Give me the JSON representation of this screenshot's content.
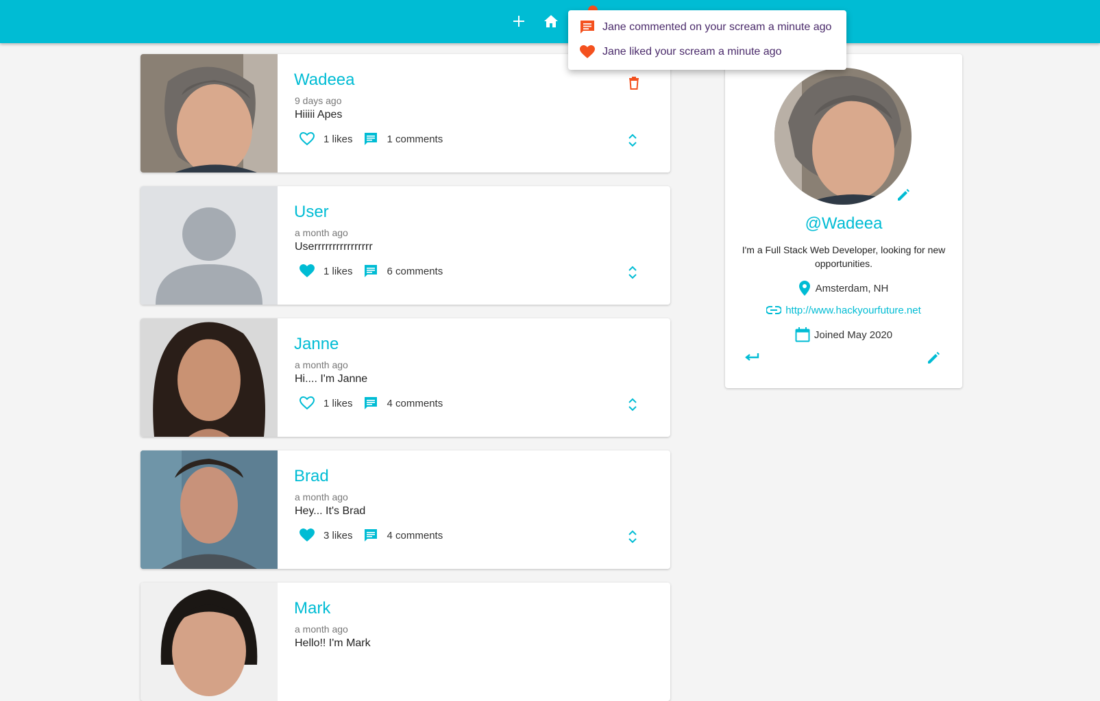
{
  "colors": {
    "primary": "#00bcd4",
    "secondary": "#f4511e",
    "background": "#f4f4f4"
  },
  "navbar": {
    "icons": [
      "add-icon",
      "home-icon",
      "notifications-icon"
    ]
  },
  "notifications": [
    {
      "icon": "comment-icon",
      "text": "Jane commented on your scream a minute ago"
    },
    {
      "icon": "heart-icon",
      "text": "Jane liked your scream a minute ago"
    }
  ],
  "screams": [
    {
      "handle": "Wadeea",
      "time": "9 days ago",
      "body": "Hiiiii Apes",
      "likes": "1 likes",
      "comments": "1 comments",
      "liked": false,
      "deletable": true
    },
    {
      "handle": "User",
      "time": "a month ago",
      "body": "Userrrrrrrrrrrrrrrr",
      "likes": "1 likes",
      "comments": "6 comments",
      "liked": true,
      "deletable": false
    },
    {
      "handle": "Janne",
      "time": "a month ago",
      "body": "Hi.... I'm Janne",
      "likes": "1 likes",
      "comments": "4 comments",
      "liked": false,
      "deletable": false
    },
    {
      "handle": "Brad",
      "time": "a month ago",
      "body": "Hey... It's Brad",
      "likes": "3 likes",
      "comments": "4 comments",
      "liked": true,
      "deletable": false
    },
    {
      "handle": "Mark",
      "time": "a month ago",
      "body": "Hello!! I'm Mark",
      "likes": "",
      "comments": "",
      "liked": false,
      "deletable": false
    }
  ],
  "profile": {
    "handle": "@Wadeea",
    "bio": "I'm a Full Stack Web Developer, looking for new opportunities.",
    "location": "Amsterdam, NH",
    "website": "http://www.hackyourfuture.net",
    "joined": "Joined May 2020"
  }
}
